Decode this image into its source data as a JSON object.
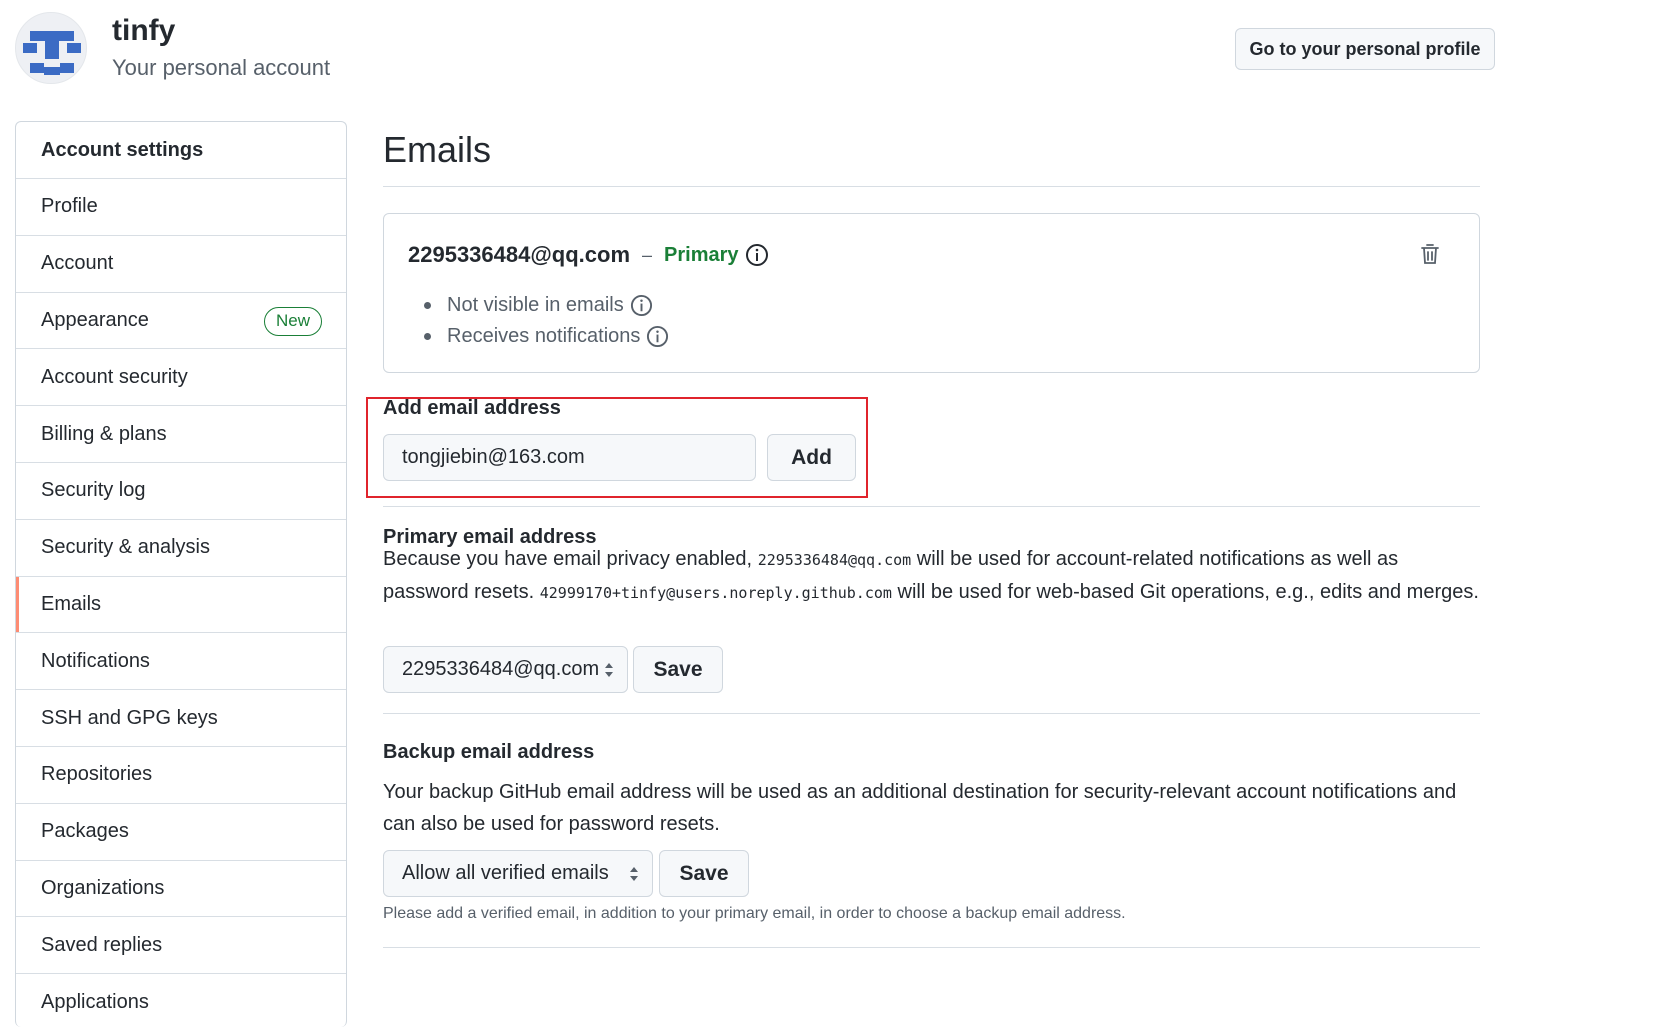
{
  "header": {
    "account_name": "tinfy",
    "account_subtitle": "Your personal account",
    "profile_button": "Go to your personal profile"
  },
  "sidebar": {
    "heading": "Account settings",
    "items": [
      {
        "label": "Profile"
      },
      {
        "label": "Account"
      },
      {
        "label": "Appearance",
        "badge": "New"
      },
      {
        "label": "Account security"
      },
      {
        "label": "Billing & plans"
      },
      {
        "label": "Security log"
      },
      {
        "label": "Security & analysis"
      },
      {
        "label": "Emails",
        "selected": true
      },
      {
        "label": "Notifications"
      },
      {
        "label": "SSH and GPG keys"
      },
      {
        "label": "Repositories"
      },
      {
        "label": "Packages"
      },
      {
        "label": "Organizations"
      },
      {
        "label": "Saved replies"
      },
      {
        "label": "Applications"
      }
    ],
    "selected_color": "#fd8c73"
  },
  "main": {
    "title": "Emails",
    "email_card": {
      "address": "2295336484@qq.com",
      "separator": "–",
      "primary_label": "Primary",
      "primary_color": "#1a7f37",
      "bullets": [
        "Not visible in emails",
        "Receives notifications"
      ],
      "delete_icon": "trash-icon"
    },
    "add_email": {
      "label": "Add email address",
      "value": "tongjiebin@163.com",
      "button": "Add",
      "highlight_color": "#e0242c"
    },
    "primary_email": {
      "title": "Primary email address",
      "text_1": "Because you have email privacy enabled,",
      "mono_1": "2295336484@qq.com",
      "text_2": "will be used for account-related notifications as well as password resets.",
      "mono_2": "42999170+tinfy@users.noreply.github.com",
      "text_3": "will be used for web-based Git operations, e.g., edits and merges.",
      "select_value": "2295336484@qq.com",
      "save": "Save"
    },
    "backup_email": {
      "title": "Backup email address",
      "description": "Your backup GitHub email address will be used as an additional destination for security-relevant account notifications and can also be used for password resets.",
      "select_value": "Allow all verified emails",
      "save": "Save",
      "note": "Please add a verified email, in addition to your primary email, in order to choose a backup email address."
    }
  }
}
